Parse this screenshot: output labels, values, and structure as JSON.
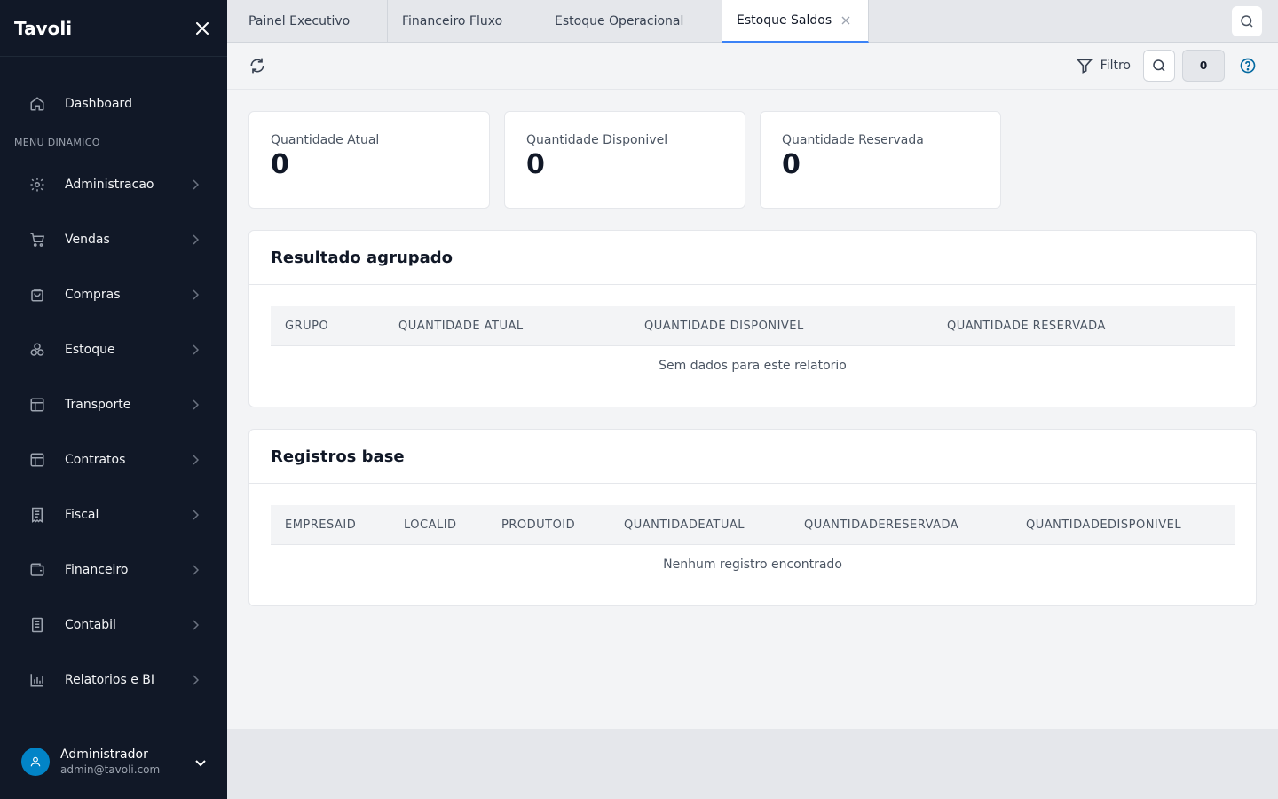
{
  "app": {
    "brand": "Tavoli"
  },
  "sidebar": {
    "dashboard": "Dashboard",
    "section_label": "MENU DINAMICO",
    "items": [
      {
        "label": "Administracao",
        "icon": "gear-icon"
      },
      {
        "label": "Vendas",
        "icon": "cart-icon"
      },
      {
        "label": "Compras",
        "icon": "shopping-bag-icon"
      },
      {
        "label": "Estoque",
        "icon": "boxes-icon"
      },
      {
        "label": "Transporte",
        "icon": "layout-icon"
      },
      {
        "label": "Contratos",
        "icon": "layout-icon"
      },
      {
        "label": "Fiscal",
        "icon": "receipt-icon"
      },
      {
        "label": "Financeiro",
        "icon": "wallet-icon"
      },
      {
        "label": "Contabil",
        "icon": "book-icon"
      },
      {
        "label": "Relatorios e BI",
        "icon": "bar-chart-icon"
      }
    ],
    "user": {
      "name": "Administrador",
      "email": "admin@tavoli.com"
    }
  },
  "tabs": [
    {
      "label": "Painel Executivo"
    },
    {
      "label": "Financeiro Fluxo"
    },
    {
      "label": "Estoque Operacional"
    },
    {
      "label": "Estoque Saldos",
      "active": true
    }
  ],
  "toolbar": {
    "filter_label": "Filtro",
    "count": "0"
  },
  "kpis": [
    {
      "label": "Quantidade Atual",
      "value": "0"
    },
    {
      "label": "Quantidade Disponivel",
      "value": "0"
    },
    {
      "label": "Quantidade Reservada",
      "value": "0"
    }
  ],
  "grouped": {
    "title": "Resultado agrupado",
    "columns": [
      "GRUPO",
      "QUANTIDADE ATUAL",
      "QUANTIDADE DISPONIVEL",
      "QUANTIDADE RESERVADA"
    ],
    "empty": "Sem dados para este relatorio"
  },
  "base": {
    "title": "Registros base",
    "columns": [
      "EMPRESAID",
      "LOCALID",
      "PRODUTOID",
      "QUANTIDADEATUAL",
      "QUANTIDADERESERVADA",
      "QUANTIDADEDISPONIVEL"
    ],
    "empty": "Nenhum registro encontrado"
  },
  "colors": {
    "sidebar_bg": "#111827",
    "accent": "#3b82f6",
    "avatar": "#0284c7",
    "help": "#0369a1"
  }
}
